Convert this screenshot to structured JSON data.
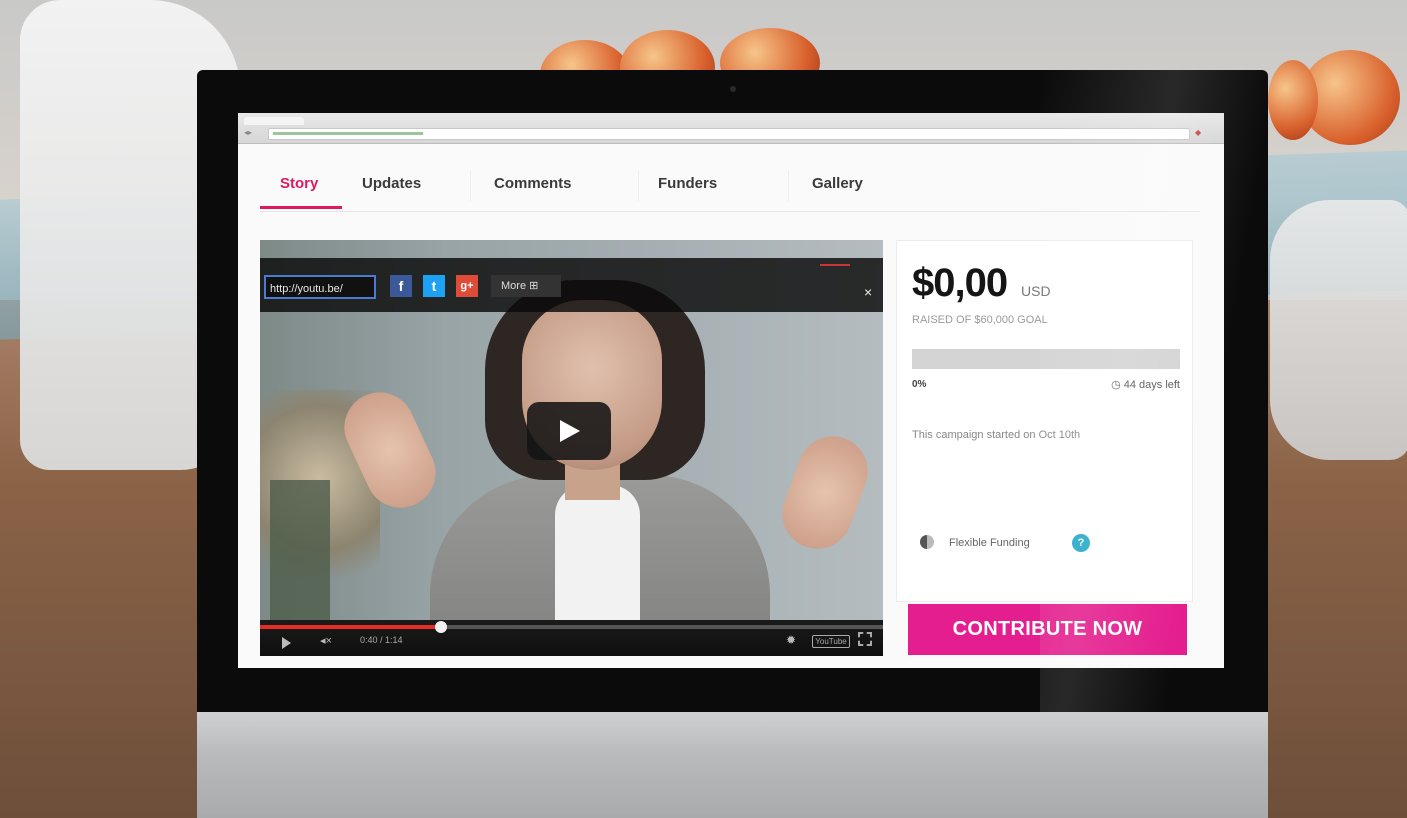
{
  "colors": {
    "accent": "#e0185f",
    "cta": "#e41e8e",
    "progress_red": "#e52d27",
    "help_teal": "#23a9c7"
  },
  "tabs": [
    {
      "label": "Story",
      "active": true
    },
    {
      "label": "Updates",
      "active": false
    },
    {
      "label": "Comments",
      "active": false
    },
    {
      "label": "Funders",
      "active": false
    },
    {
      "label": "Gallery",
      "active": false
    }
  ],
  "video": {
    "share_url": "http://youtu.be/",
    "share_icons": [
      "facebook-icon",
      "twitter-icon",
      "google-plus-icon"
    ],
    "more_label": "More",
    "close_glyph": "×",
    "time": "0:40 / 1:14",
    "playback_progress": 0.29,
    "youtube_label": "YouTube"
  },
  "campaign": {
    "amount": "$0,00",
    "currency": "USD",
    "raised_text": "RAISED OF $60,000 GOAL",
    "progress_percent": 0,
    "percent_label": "0%",
    "days_left": "44 days left",
    "started_text": "This campaign started on Oct 10th",
    "funding_type": "Flexible Funding",
    "help_glyph": "?",
    "cta_label": "CONTRIBUTE NOW"
  }
}
